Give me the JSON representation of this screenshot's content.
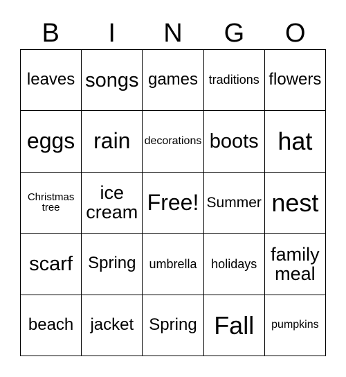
{
  "card": {
    "type": "bingo-card",
    "background_color": "#ffffff",
    "text_color": "#000000",
    "border_color": "#000000",
    "columns": 5,
    "rows": 5
  },
  "header": {
    "letters": [
      "B",
      "I",
      "N",
      "G",
      "O"
    ]
  },
  "grid": {
    "rows": [
      [
        {
          "label": "leaves",
          "size": "sm",
          "free": false
        },
        {
          "label": "songs",
          "size": "ml",
          "free": false
        },
        {
          "label": "games",
          "size": "sm",
          "free": false
        },
        {
          "label": "traditions",
          "size": "xxs",
          "free": false
        },
        {
          "label": "flowers",
          "size": "sm",
          "free": false
        }
      ],
      [
        {
          "label": "eggs",
          "size": "lg",
          "free": false
        },
        {
          "label": "rain",
          "size": "lg",
          "free": false
        },
        {
          "label": "decorations",
          "size": "tiny",
          "free": false
        },
        {
          "label": "boots",
          "size": "ml",
          "free": false
        },
        {
          "label": "hat",
          "size": "xl",
          "free": false
        }
      ],
      [
        {
          "label": "Christmas\ntree",
          "size": "mini",
          "free": false
        },
        {
          "label": "ice\ncream",
          "size": "md",
          "free": false
        },
        {
          "label": "Free!",
          "size": "lg",
          "free": true
        },
        {
          "label": "Summer",
          "size": "xs",
          "free": false
        },
        {
          "label": "nest",
          "size": "xl",
          "free": false
        }
      ],
      [
        {
          "label": "scarf",
          "size": "ml",
          "free": false
        },
        {
          "label": "Spring",
          "size": "sm",
          "free": false
        },
        {
          "label": "umbrella",
          "size": "xxs",
          "free": false
        },
        {
          "label": "holidays",
          "size": "xxs",
          "free": false
        },
        {
          "label": "family\nmeal",
          "size": "md",
          "free": false
        }
      ],
      [
        {
          "label": "beach",
          "size": "sm",
          "free": false
        },
        {
          "label": "jacket",
          "size": "sm",
          "free": false
        },
        {
          "label": "Spring",
          "size": "sm",
          "free": false
        },
        {
          "label": "Fall",
          "size": "xl",
          "free": false
        },
        {
          "label": "pumpkins",
          "size": "tiny",
          "free": false
        }
      ]
    ]
  }
}
